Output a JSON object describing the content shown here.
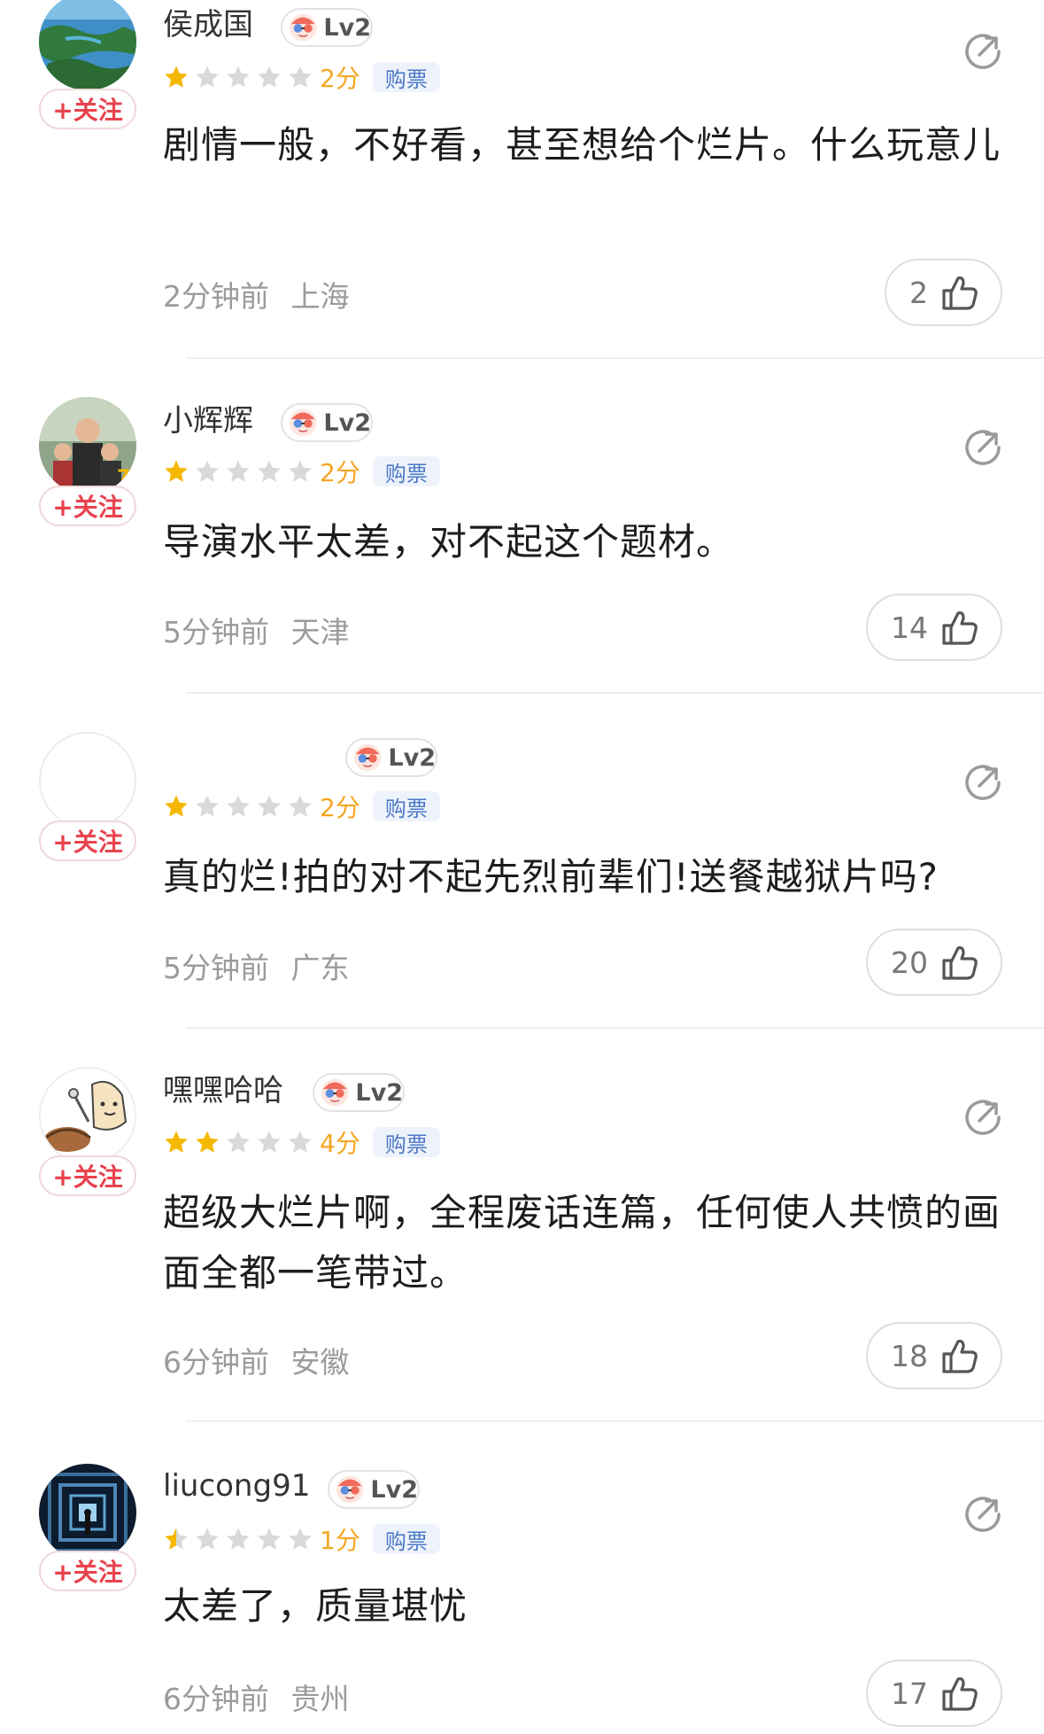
{
  "labels": {
    "follow": "+关注",
    "ticket": "购票"
  },
  "colors": {
    "star_filled": "#f5b800",
    "star_empty": "#d9d9d9",
    "follow_red": "#e8434e",
    "score": "#f5a623",
    "ticket_blue": "#4b78c6"
  },
  "reviews": [
    {
      "username": "侯成国",
      "level": "Lv2",
      "rating_stars": 1,
      "score": "2分",
      "text": "剧情一般，不好看，甚至想给个烂片。什么玩意儿",
      "time": "2分钟前",
      "location": "上海",
      "likes": "2",
      "avatar": "ocean-island-photo"
    },
    {
      "username": "小辉辉",
      "level": "Lv2",
      "rating_stars": 1,
      "score": "2分",
      "text": "导演水平太差，对不起这个题材。",
      "time": "5分钟前",
      "location": "天津",
      "likes": "14",
      "avatar": "family-photo"
    },
    {
      "username": "",
      "level": "Lv2",
      "rating_stars": 1,
      "score": "2分",
      "text": "真的烂!拍的对不起先烈前辈们!送餐越狱片吗?",
      "time": "5分钟前",
      "location": "广东",
      "likes": "20",
      "avatar": "blank"
    },
    {
      "username": "嘿嘿哈哈",
      "level": "Lv2",
      "rating_stars": 2,
      "score": "4分",
      "text": "超级大烂片啊，全程废话连篇，任何使人共愤的画面全都一笔带过。",
      "time": "6分钟前",
      "location": "安徽",
      "likes": "18",
      "avatar": "cartoon-character"
    },
    {
      "username": "liucong91",
      "level": "Lv2",
      "rating_stars": 0.5,
      "score": "1分",
      "text": "太差了，质量堪忧",
      "time": "6分钟前",
      "location": "贵州",
      "likes": "17",
      "avatar": "corridor-photo"
    }
  ]
}
